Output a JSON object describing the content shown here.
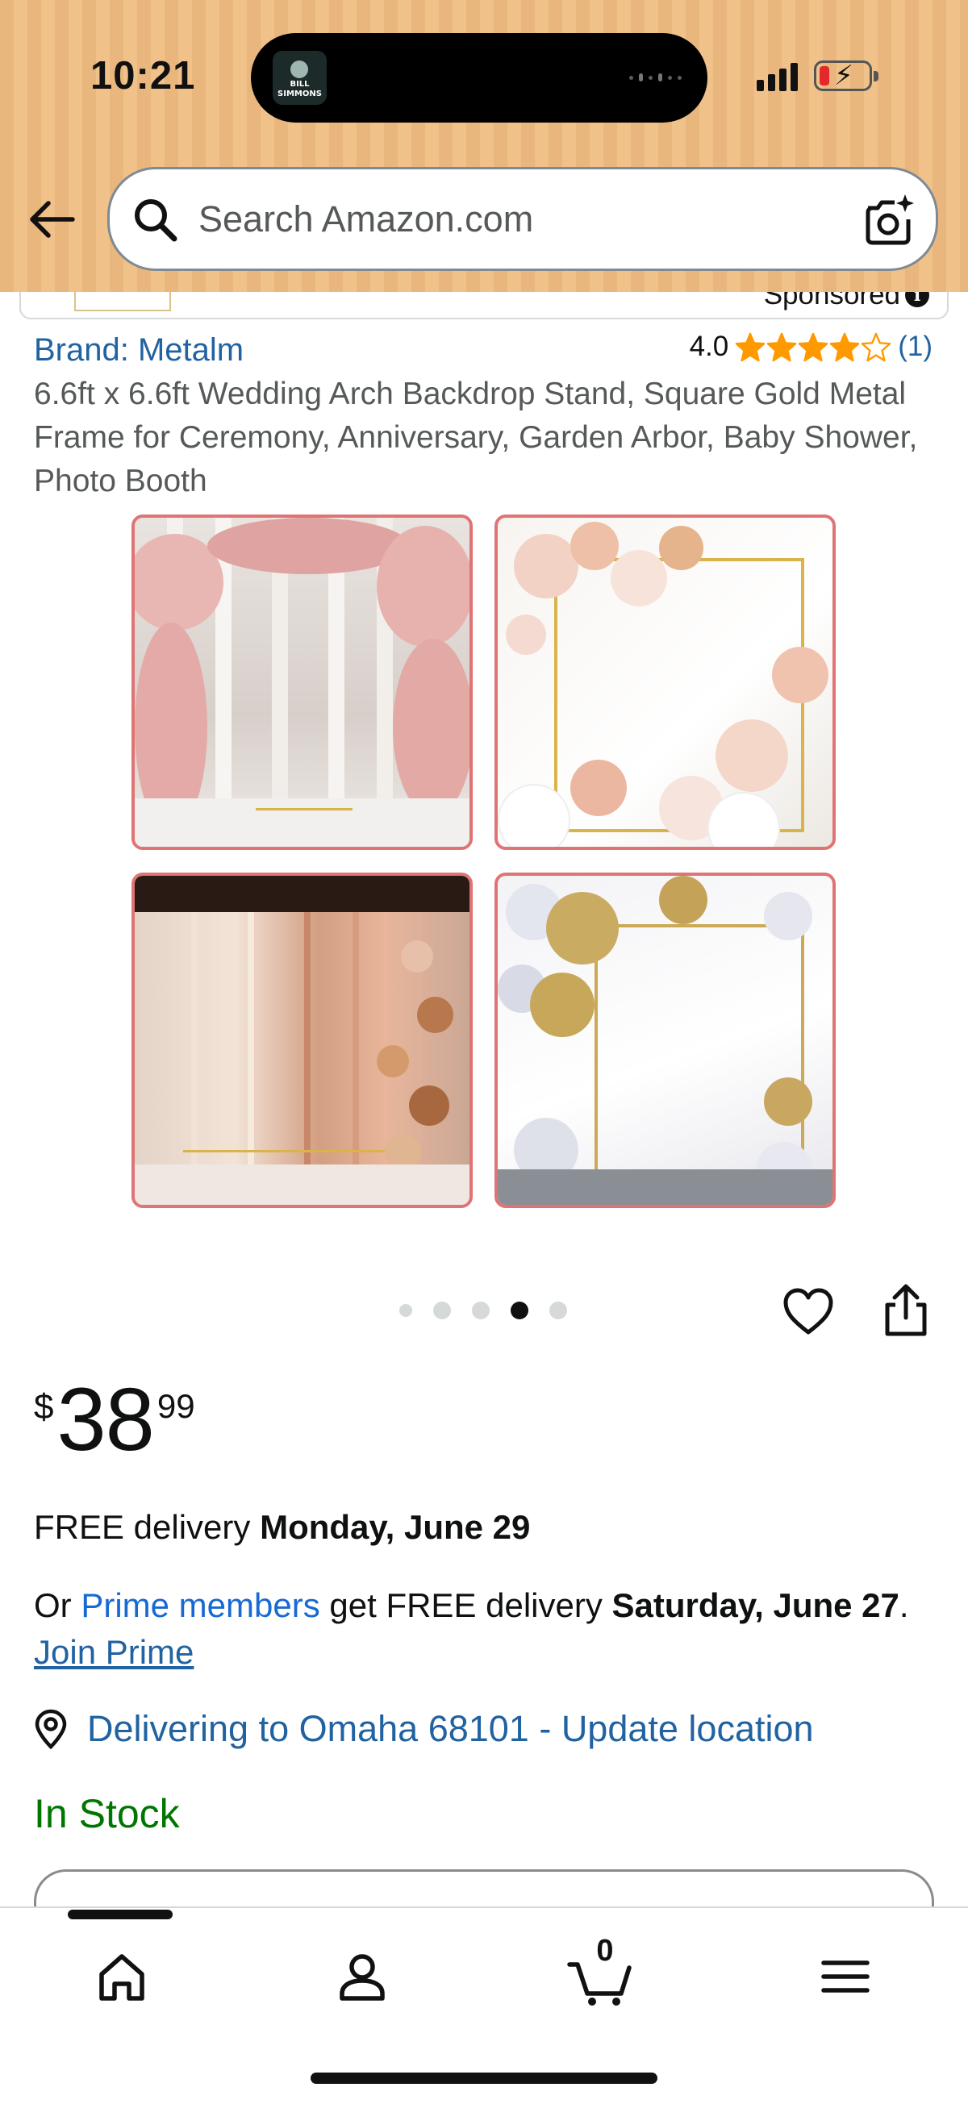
{
  "status_bar": {
    "time": "10:21",
    "now_playing_art_line1": "BILL",
    "now_playing_art_line2": "SIMMONS"
  },
  "header": {
    "search_placeholder": "Search Amazon.com",
    "back_icon": "arrow-left-icon",
    "camera_icon": "camera-sparkle-icon"
  },
  "sponsored_peek": {
    "label": "Sponsored",
    "info_glyph": "i"
  },
  "product": {
    "brand_link": "Brand: Metalm",
    "rating_value": "4.0",
    "rating_stars": 4,
    "rating_count": "(1)",
    "title": "6.6ft x 6.6ft Wedding Arch Backdrop Stand, Square Gold Metal Frame for Ceremony, Anniversary, Garden Arbor, Baby Shower, Photo Booth"
  },
  "carousel": {
    "dot_count": 5,
    "active_dot": 3
  },
  "price": {
    "currency": "$",
    "whole": "38",
    "fraction": "99"
  },
  "delivery": {
    "line1_prefix": "FREE delivery ",
    "line1_date": "Monday, June 29",
    "line2_prefix": "Or ",
    "prime_members_link": "Prime members",
    "line2_middle": " get FREE delivery ",
    "line2_date": "Saturday, June 27",
    "line2_sep": ". ",
    "join_prime_link": "Join Prime",
    "location_link": "Delivering to Omaha 68101 - Update location"
  },
  "availability": {
    "stock_text": "In Stock"
  },
  "bottom_nav": {
    "cart_count": "0",
    "items": [
      "home-icon",
      "account-icon",
      "cart-icon",
      "menu-icon"
    ]
  },
  "colors": {
    "link_blue": "#2162a1",
    "prime_blue": "#1769d4",
    "star_orange": "#ff9900",
    "in_stock_green": "#007600",
    "photo_border": "#e07474"
  }
}
